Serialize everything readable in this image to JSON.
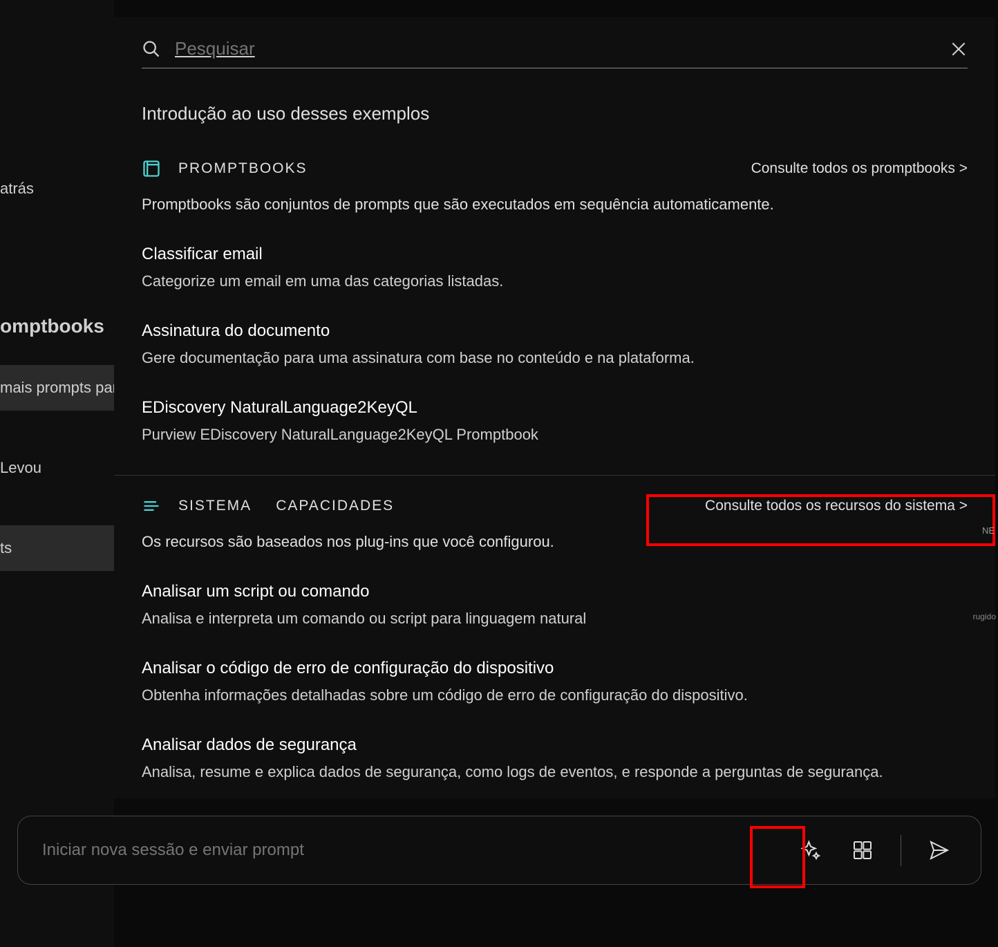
{
  "sidebar": {
    "items": [
      {
        "label": "atrás"
      },
      {
        "label": "omptbooks"
      },
      {
        "label": " mais prompts para"
      },
      {
        "label": "Levou"
      },
      {
        "label": "ts"
      }
    ]
  },
  "search": {
    "placeholder": "Pesquisar"
  },
  "intro": "Introdução ao uso desses exemplos",
  "promptbooks": {
    "title": "PROMPTBOOKS",
    "link": "Consulte todos os promptbooks >",
    "desc": "Promptbooks são conjuntos de prompts que são executados em sequência automaticamente.",
    "items": [
      {
        "title": "Classificar email",
        "desc": "Categorize um email em uma das categorias listadas."
      },
      {
        "title": "Assinatura do documento",
        "desc": "Gere documentação para uma assinatura com base no conteúdo e na plataforma."
      },
      {
        "title": "EDiscovery NaturalLanguage2KeyQL",
        "desc": "Purview EDiscovery NaturalLanguage2KeyQL Promptbook"
      }
    ]
  },
  "system": {
    "title": "SISTEMA",
    "subtitle": "CAPACIDADES",
    "link": "Consulte todos os recursos do sistema >",
    "desc": "Os recursos são baseados nos plug-ins que você configurou.",
    "items": [
      {
        "title": "Analisar um script ou comando",
        "desc": "Analisa e interpreta um comando ou script para linguagem natural"
      },
      {
        "title": "Analisar o código de erro de configuração do dispositivo",
        "desc": "Obtenha informações detalhadas sobre um código de erro de configuração do dispositivo."
      },
      {
        "title": "Analisar dados de segurança",
        "desc": "Analisa, resume e explica dados de segurança, como logs de eventos, e responde a perguntas de segurança."
      }
    ]
  },
  "bottom": {
    "placeholder": "Iniciar nova sessão e enviar prompt"
  },
  "corner": {
    "ne": "NE",
    "rugido": "rugido"
  }
}
